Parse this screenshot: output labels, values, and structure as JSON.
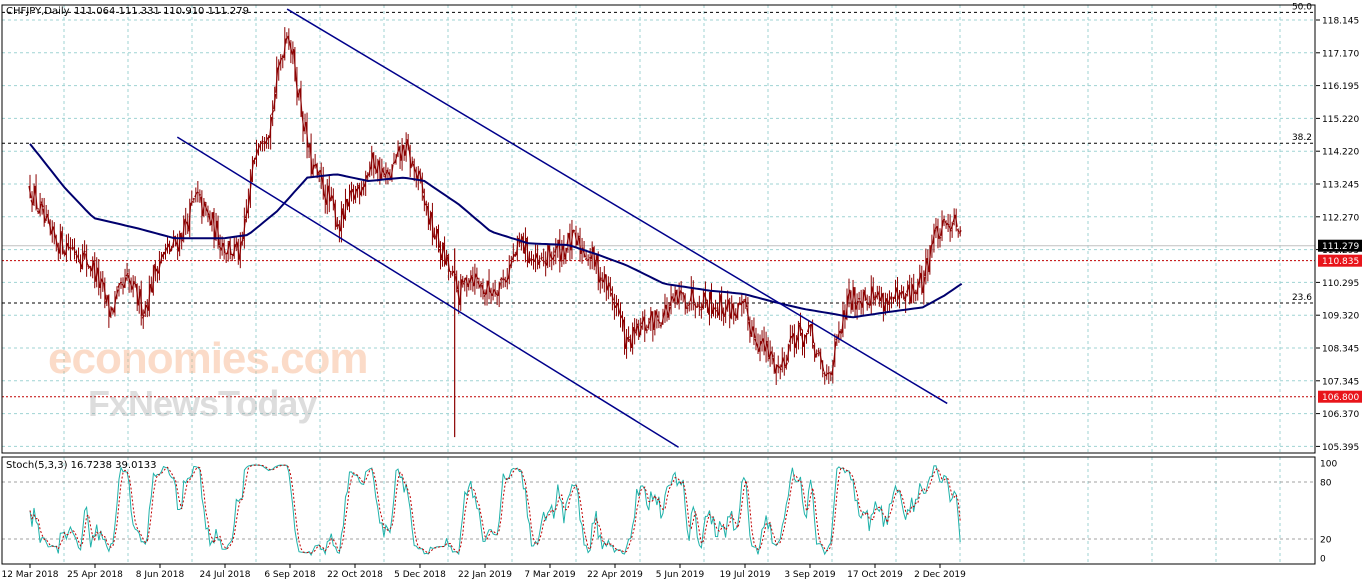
{
  "header": {
    "title": "CHFJPY,Daily",
    "ohlc": "111.064 111.331 110.910 111.279"
  },
  "watermark": {
    "line1": "economies.com",
    "line2": "FxNewsToday"
  },
  "colors": {
    "background": "#ffffff",
    "grid": "#9fd3d3",
    "candle": "#8b0000",
    "moving_average": "#00006e",
    "channel": "#00008b",
    "fib_level": "#000000",
    "support_line": "#c00000",
    "stoch_main": "#20b2aa",
    "stoch_signal": "#c00000",
    "price_tag_bg": "#000000",
    "level_tag_bg": "#e8141a"
  },
  "price_panel": {
    "y_ticks": [
      "118.145",
      "117.170",
      "116.195",
      "115.220",
      "114.220",
      "113.245",
      "112.270",
      "111.295",
      "110.295",
      "109.320",
      "108.345",
      "107.345",
      "106.370",
      "105.395"
    ],
    "current_price": "111.279",
    "horizontal_levels": [
      {
        "label": "50.0",
        "price": 118.2,
        "style": "fib"
      },
      {
        "label": "38.2",
        "price": 114.32,
        "style": "fib"
      },
      {
        "label": "23.6",
        "price": 109.58,
        "style": "fib"
      },
      {
        "label": "110.835",
        "price": 110.835,
        "style": "support",
        "tag": true
      },
      {
        "label": "106.800",
        "price": 106.8,
        "style": "support",
        "tag": true
      }
    ]
  },
  "stoch_panel": {
    "title": "Stoch(5,3,3) 16.7238 39.0133",
    "y_ticks": [
      "100",
      "80",
      "20",
      "0"
    ],
    "levels": [
      80,
      20
    ]
  },
  "x_axis": {
    "labels": [
      "12 Mar 2018",
      "25 Apr 2018",
      "8 Jun 2018",
      "24 Jul 2018",
      "6 Sep 2018",
      "22 Oct 2018",
      "5 Dec 2018",
      "22 Jan 2019",
      "7 Mar 2019",
      "22 Apr 2019",
      "5 Jun 2019",
      "19 Jul 2019",
      "3 Sep 2019",
      "17 Oct 2019",
      "2 Dec 2019"
    ]
  },
  "chart_data": {
    "type": "candlestick",
    "symbol": "CHFJPY",
    "timeframe": "Daily",
    "title": "CHFJPY,Daily",
    "ylim": [
      105.2,
      118.8
    ],
    "close_anchors": [
      {
        "date": "2018-03-12",
        "close": 113.0
      },
      {
        "date": "2018-03-26",
        "close": 111.5
      },
      {
        "date": "2018-04-12",
        "close": 111.2
      },
      {
        "date": "2018-04-25",
        "close": 110.6
      },
      {
        "date": "2018-05-06",
        "close": 109.3
      },
      {
        "date": "2018-05-18",
        "close": 110.2
      },
      {
        "date": "2018-05-30",
        "close": 109.4
      },
      {
        "date": "2018-06-08",
        "close": 110.8
      },
      {
        "date": "2018-06-22",
        "close": 111.4
      },
      {
        "date": "2018-07-05",
        "close": 112.7
      },
      {
        "date": "2018-07-24",
        "close": 111.3
      },
      {
        "date": "2018-08-05",
        "close": 111.0
      },
      {
        "date": "2018-08-16",
        "close": 114.5
      },
      {
        "date": "2018-08-25",
        "close": 114.9
      },
      {
        "date": "2018-09-01",
        "close": 116.8
      },
      {
        "date": "2018-09-06",
        "close": 117.8
      },
      {
        "date": "2018-09-13",
        "close": 116.0
      },
      {
        "date": "2018-09-22",
        "close": 113.7
      },
      {
        "date": "2018-10-03",
        "close": 112.8
      },
      {
        "date": "2018-10-12",
        "close": 111.9
      },
      {
        "date": "2018-10-22",
        "close": 112.8
      },
      {
        "date": "2018-11-05",
        "close": 113.8
      },
      {
        "date": "2018-11-14",
        "close": 113.2
      },
      {
        "date": "2018-11-26",
        "close": 114.2
      },
      {
        "date": "2018-12-05",
        "close": 113.3
      },
      {
        "date": "2018-12-15",
        "close": 111.8
      },
      {
        "date": "2019-01-03",
        "close": 109.8
      },
      {
        "date": "2019-01-10",
        "close": 110.5
      },
      {
        "date": "2019-01-22",
        "close": 109.9
      },
      {
        "date": "2019-02-03",
        "close": 110.3
      },
      {
        "date": "2019-02-15",
        "close": 111.4
      },
      {
        "date": "2019-02-26",
        "close": 110.6
      },
      {
        "date": "2019-03-07",
        "close": 111.0
      },
      {
        "date": "2019-03-23",
        "close": 111.4
      },
      {
        "date": "2019-04-04",
        "close": 111.0
      },
      {
        "date": "2019-04-22",
        "close": 109.5
      },
      {
        "date": "2019-04-29",
        "close": 108.3
      },
      {
        "date": "2019-05-11",
        "close": 108.9
      },
      {
        "date": "2019-05-22",
        "close": 109.2
      },
      {
        "date": "2019-06-05",
        "close": 109.7
      },
      {
        "date": "2019-06-17",
        "close": 109.8
      },
      {
        "date": "2019-07-01",
        "close": 109.5
      },
      {
        "date": "2019-07-19",
        "close": 109.3
      },
      {
        "date": "2019-07-30",
        "close": 108.4
      },
      {
        "date": "2019-08-13",
        "close": 107.6
      },
      {
        "date": "2019-08-21",
        "close": 108.6
      },
      {
        "date": "2019-09-03",
        "close": 108.6
      },
      {
        "date": "2019-09-13",
        "close": 107.3
      },
      {
        "date": "2019-09-21",
        "close": 108.2
      },
      {
        "date": "2019-09-29",
        "close": 109.6
      },
      {
        "date": "2019-10-10",
        "close": 109.9
      },
      {
        "date": "2019-10-24",
        "close": 109.7
      },
      {
        "date": "2019-11-05",
        "close": 109.6
      },
      {
        "date": "2019-11-20",
        "close": 110.2
      },
      {
        "date": "2019-11-27",
        "close": 111.6
      },
      {
        "date": "2019-12-05",
        "close": 111.7
      },
      {
        "date": "2019-12-12",
        "close": 112.3
      },
      {
        "date": "2019-12-17",
        "close": 111.279
      }
    ],
    "moving_average": [
      {
        "date": "2018-03-12",
        "value": 114.3
      },
      {
        "date": "2018-04-05",
        "value": 113.0
      },
      {
        "date": "2018-04-25",
        "value": 112.1
      },
      {
        "date": "2018-05-25",
        "value": 111.8
      },
      {
        "date": "2018-06-20",
        "value": 111.5
      },
      {
        "date": "2018-07-24",
        "value": 111.5
      },
      {
        "date": "2018-08-10",
        "value": 111.6
      },
      {
        "date": "2018-08-30",
        "value": 112.3
      },
      {
        "date": "2018-09-20",
        "value": 113.3
      },
      {
        "date": "2018-10-10",
        "value": 113.4
      },
      {
        "date": "2018-11-01",
        "value": 113.2
      },
      {
        "date": "2018-11-26",
        "value": 113.3
      },
      {
        "date": "2018-12-10",
        "value": 113.2
      },
      {
        "date": "2019-01-03",
        "value": 112.5
      },
      {
        "date": "2019-01-25",
        "value": 111.7
      },
      {
        "date": "2019-02-20",
        "value": 111.35
      },
      {
        "date": "2019-03-20",
        "value": 111.3
      },
      {
        "date": "2019-04-10",
        "value": 111.0
      },
      {
        "date": "2019-04-29",
        "value": 110.7
      },
      {
        "date": "2019-05-25",
        "value": 110.15
      },
      {
        "date": "2019-06-25",
        "value": 109.95
      },
      {
        "date": "2019-07-19",
        "value": 109.85
      },
      {
        "date": "2019-08-10",
        "value": 109.6
      },
      {
        "date": "2019-08-30",
        "value": 109.4
      },
      {
        "date": "2019-09-20",
        "value": 109.25
      },
      {
        "date": "2019-10-02",
        "value": 109.15
      },
      {
        "date": "2019-10-25",
        "value": 109.3
      },
      {
        "date": "2019-11-20",
        "value": 109.45
      },
      {
        "date": "2019-12-05",
        "value": 109.8
      },
      {
        "date": "2019-12-17",
        "value": 110.15
      }
    ],
    "channel_lines": [
      {
        "from": {
          "date": "2018-09-06",
          "price": 118.3
        },
        "to": {
          "date": "2019-12-07",
          "price": 106.6
        }
      },
      {
        "from": {
          "date": "2018-06-22",
          "price": 114.5
        },
        "to": {
          "date": "2019-06-04",
          "price": 105.3
        }
      }
    ],
    "spike_low": {
      "date": "2018-12-31",
      "low": 105.6
    },
    "stochastic": {
      "name": "Stoch(5,3,3)",
      "main": 16.7238,
      "signal": 39.0133,
      "levels": [
        80,
        20
      ],
      "ylim": [
        0,
        100
      ]
    }
  }
}
